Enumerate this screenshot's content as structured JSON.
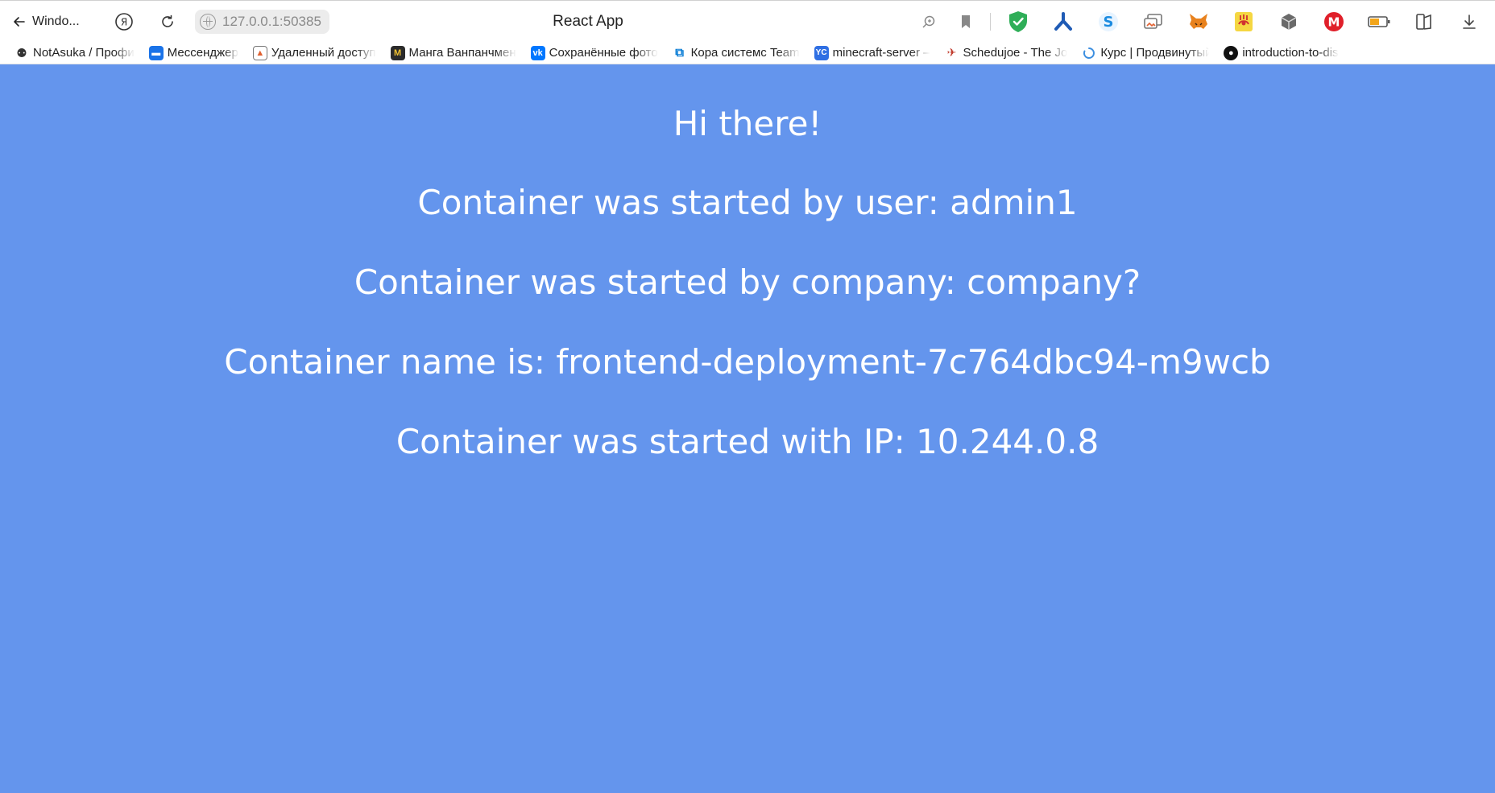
{
  "browser": {
    "back_label": "Windo...",
    "address": "127.0.0.1:50385",
    "title": "React App",
    "extension_icons": [
      "zoom-icon",
      "bookmark-icon",
      "shield-check-icon",
      "vpn-icon",
      "s-extension-icon",
      "cast-icon",
      "metamask-fox-icon",
      "eye-extension-icon",
      "cube-extension-icon",
      "m-extension-icon",
      "battery-icon",
      "reading-list-icon",
      "download-icon"
    ]
  },
  "bookmarks": [
    {
      "label": "NotAsuka / Профи",
      "icon": "notasuka-icon",
      "color": "#333333"
    },
    {
      "label": "Мессенджер",
      "icon": "messenger-icon",
      "color": "#1a73e8"
    },
    {
      "label": "Удаленный доступ",
      "icon": "remote-desktop-icon",
      "color": "#e06030"
    },
    {
      "label": "Манга Ванпанчмен",
      "icon": "manga-icon",
      "color": "#2b2b2b"
    },
    {
      "label": "Сохранённые фото",
      "icon": "vk-icon",
      "color": "#0077ff"
    },
    {
      "label": "Кора системс Team",
      "icon": "azure-devops-icon",
      "color": "#0078d4"
    },
    {
      "label": "minecraft-server –",
      "icon": "yandex-cloud-icon",
      "color": "#2f6fe3"
    },
    {
      "label": "Schedujoe - The Jo",
      "icon": "schedujoe-icon",
      "color": "#c0392b"
    },
    {
      "label": "Курс | Продвинутый",
      "icon": "course-loader-icon",
      "color": "#3d8fe0"
    },
    {
      "label": "introduction-to-dis",
      "icon": "github-icon",
      "color": "#111111"
    }
  ],
  "content": {
    "greeting": "Hi there!",
    "user_line": "Container was started by user: admin1",
    "company_line": "Container was started by company: company?",
    "name_line": "Container name is: frontend-deployment-7c764dbc94-m9wcb",
    "ip_line": "Container was started with IP: 10.244.0.8"
  },
  "colors": {
    "page_background": "#6495ed",
    "text": "#ffffff"
  }
}
